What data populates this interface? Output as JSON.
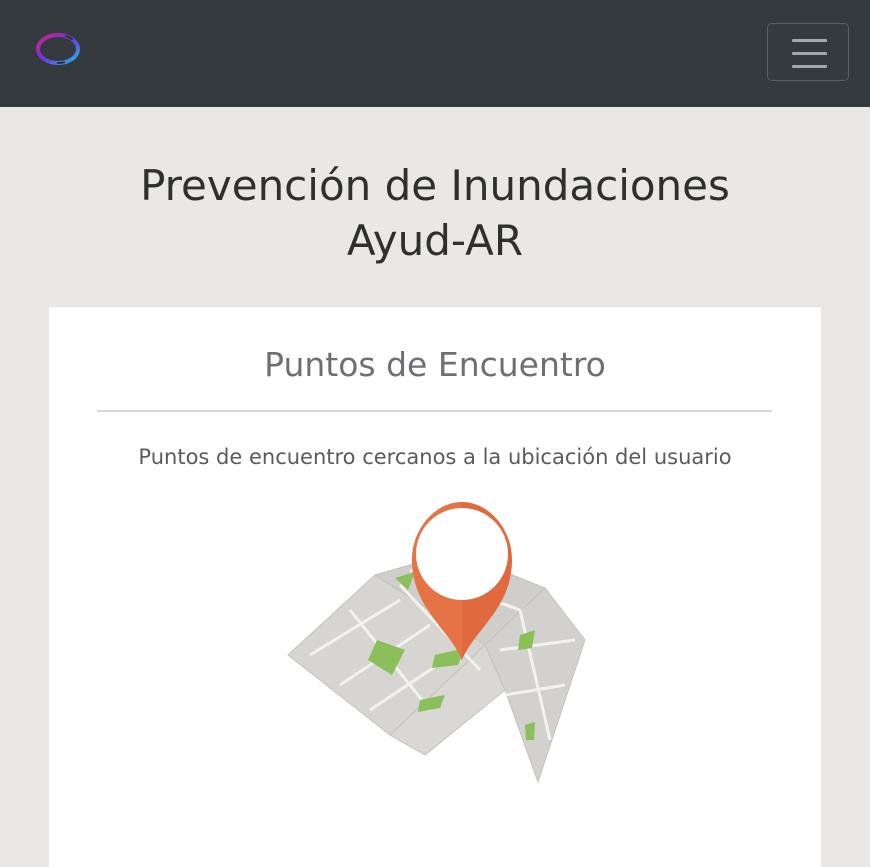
{
  "navbar": {
    "logo_name": "ring-logo",
    "menu_icon": "hamburger-icon"
  },
  "header": {
    "title_line1": "Prevención de Inundaciones",
    "title_line2": "Ayud-AR"
  },
  "card": {
    "title": "Puntos de Encuentro",
    "text": "Puntos de encuentro cercanos a la ubicación del usuario",
    "image": "map-with-location-pin"
  },
  "colors": {
    "navbar_bg": "#353a3e",
    "page_bg": "#e9e8e5",
    "pin": "#e0693d",
    "map_green": "#8bbf5a"
  }
}
